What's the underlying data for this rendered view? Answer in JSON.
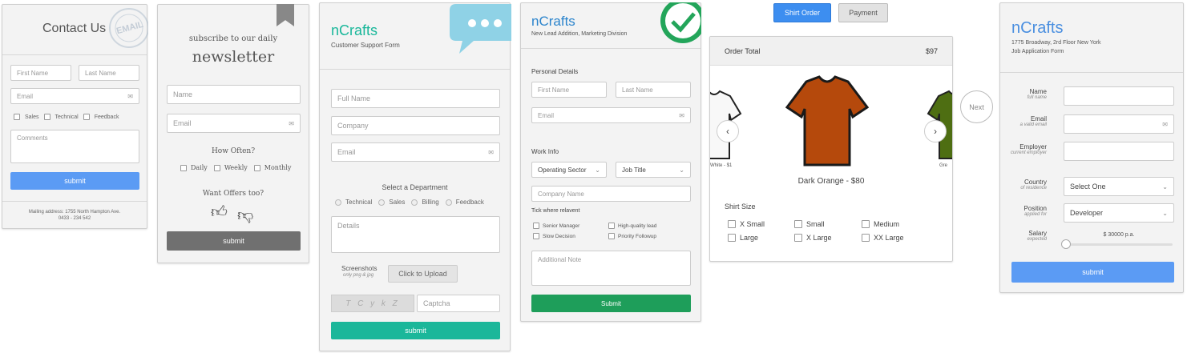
{
  "card1": {
    "title": "Contact Us",
    "stamp": "EMAIL",
    "first_name": "First Name",
    "last_name": "Last Name",
    "email": "Email",
    "checks": [
      "Sales",
      "Technical",
      "Feedback"
    ],
    "comments": "Comments",
    "submit": "submit",
    "address": "Mailing address: 1755 North Hampton Ave.",
    "phone": "0433 - 234 542"
  },
  "card2": {
    "subtitle": "subscribe to our daily",
    "title": "newsletter",
    "name": "Name",
    "email": "Email",
    "how_often": "How Often?",
    "freq": [
      "Daily",
      "Weekly",
      "Monthly"
    ],
    "offers": "Want Offers too?",
    "submit": "submit"
  },
  "card3": {
    "brand": "nCrafts",
    "subtitle": "Customer Support Form",
    "full_name": "Full Name",
    "company": "Company",
    "email": "Email",
    "dept_title": "Select a Department",
    "depts": [
      "Technical",
      "Sales",
      "Billing",
      "Feedback"
    ],
    "details": "Details",
    "screens_label": "Screenshots",
    "screens_hint": "only png & jpg",
    "upload": "Click to Upload",
    "captcha_text": "T C y k Z",
    "captcha": "Captcha",
    "submit": "submit"
  },
  "card4": {
    "brand": "nCrafts",
    "subtitle": "New Lead Addition, Marketing Division",
    "personal": "Personal Details",
    "first_name": "First Name",
    "last_name": "Last Name",
    "email": "Email",
    "work": "Work Info",
    "sector": "Operating Sector",
    "job": "Job Title",
    "company": "Company Name",
    "tick": "Tick where relavent",
    "ticks": [
      "Senior Manager",
      "High-quality lead",
      "Slow Decision",
      "Priority Followup"
    ],
    "note": "Additional Note",
    "submit": "Submit"
  },
  "card5": {
    "tab_order": "Shirt Order",
    "tab_payment": "Payment",
    "order_total": "Order Total",
    "price": "$97",
    "left_caption": "White - $1",
    "right_caption": "Gre",
    "caption": "Dark Orange - $80",
    "size_title": "Shirt Size",
    "sizes": [
      "X Small",
      "Small",
      "Medium",
      "Large",
      "X Large",
      "XX Large"
    ],
    "next": "Next",
    "colors": {
      "main": "#b5490c",
      "right": "#4e6e12"
    }
  },
  "card6": {
    "brand": "nCrafts",
    "address": "1775 Broadway, 2rd Floor New York",
    "subtitle": "Job Application Form",
    "name_label": "Name",
    "name_hint": "full name",
    "email_label": "Email",
    "email_hint": "a valid email",
    "employer_label": "Employer",
    "employer_hint": "current employer",
    "country_label": "Country",
    "country_hint": "of residence",
    "country_value": "Select One",
    "position_label": "Position",
    "position_hint": "applied for",
    "position_value": "Developer",
    "salary_label": "Salary",
    "salary_hint": "expected",
    "salary_value": "$ 30000 p.a.",
    "submit": "submit"
  }
}
